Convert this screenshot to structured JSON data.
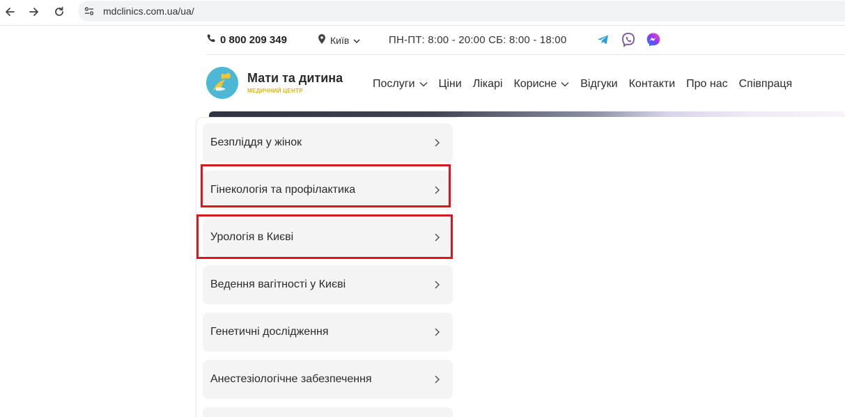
{
  "browser": {
    "url": "mdclinics.com.ua/ua/"
  },
  "topbar": {
    "phone": "0 800 209 349",
    "city": "Київ",
    "hours": "ПН-ПТ: 8:00 - 20:00  СБ: 8:00 - 18:00",
    "social_icons": [
      "telegram-icon",
      "viber-icon",
      "messenger-icon"
    ]
  },
  "header": {
    "brand": "Мати та дитина",
    "brand_subtitle": "МЕДИЧНИЙ ЦЕНТР",
    "nav": [
      {
        "label": "Послуги",
        "has_dropdown": true
      },
      {
        "label": "Ціни",
        "has_dropdown": false
      },
      {
        "label": "Лікарі",
        "has_dropdown": false
      },
      {
        "label": "Корисне",
        "has_dropdown": true
      },
      {
        "label": "Відгуки",
        "has_dropdown": false
      },
      {
        "label": "Контакти",
        "has_dropdown": false
      },
      {
        "label": "Про нас",
        "has_dropdown": false
      },
      {
        "label": "Співпраця",
        "has_dropdown": false
      }
    ]
  },
  "services_menu": {
    "items": [
      {
        "label": "Безпліддя у жінок",
        "highlighted": false
      },
      {
        "label": "Гінекологія та профілактика",
        "highlighted": true
      },
      {
        "label": "Урологія в Києві",
        "highlighted": true
      },
      {
        "label": "Ведення вагітності у Києві",
        "highlighted": false
      },
      {
        "label": "Генетичні дослідження",
        "highlighted": false
      },
      {
        "label": "Анестезіологічне забезпечення",
        "highlighted": false
      },
      {
        "label": "",
        "highlighted": false
      }
    ]
  },
  "colors": {
    "highlight": "#d7191f",
    "brand_yellow": "#e0b31a",
    "brand_teal": "#4db8d6",
    "menu_bg": "#f4f4f4"
  }
}
